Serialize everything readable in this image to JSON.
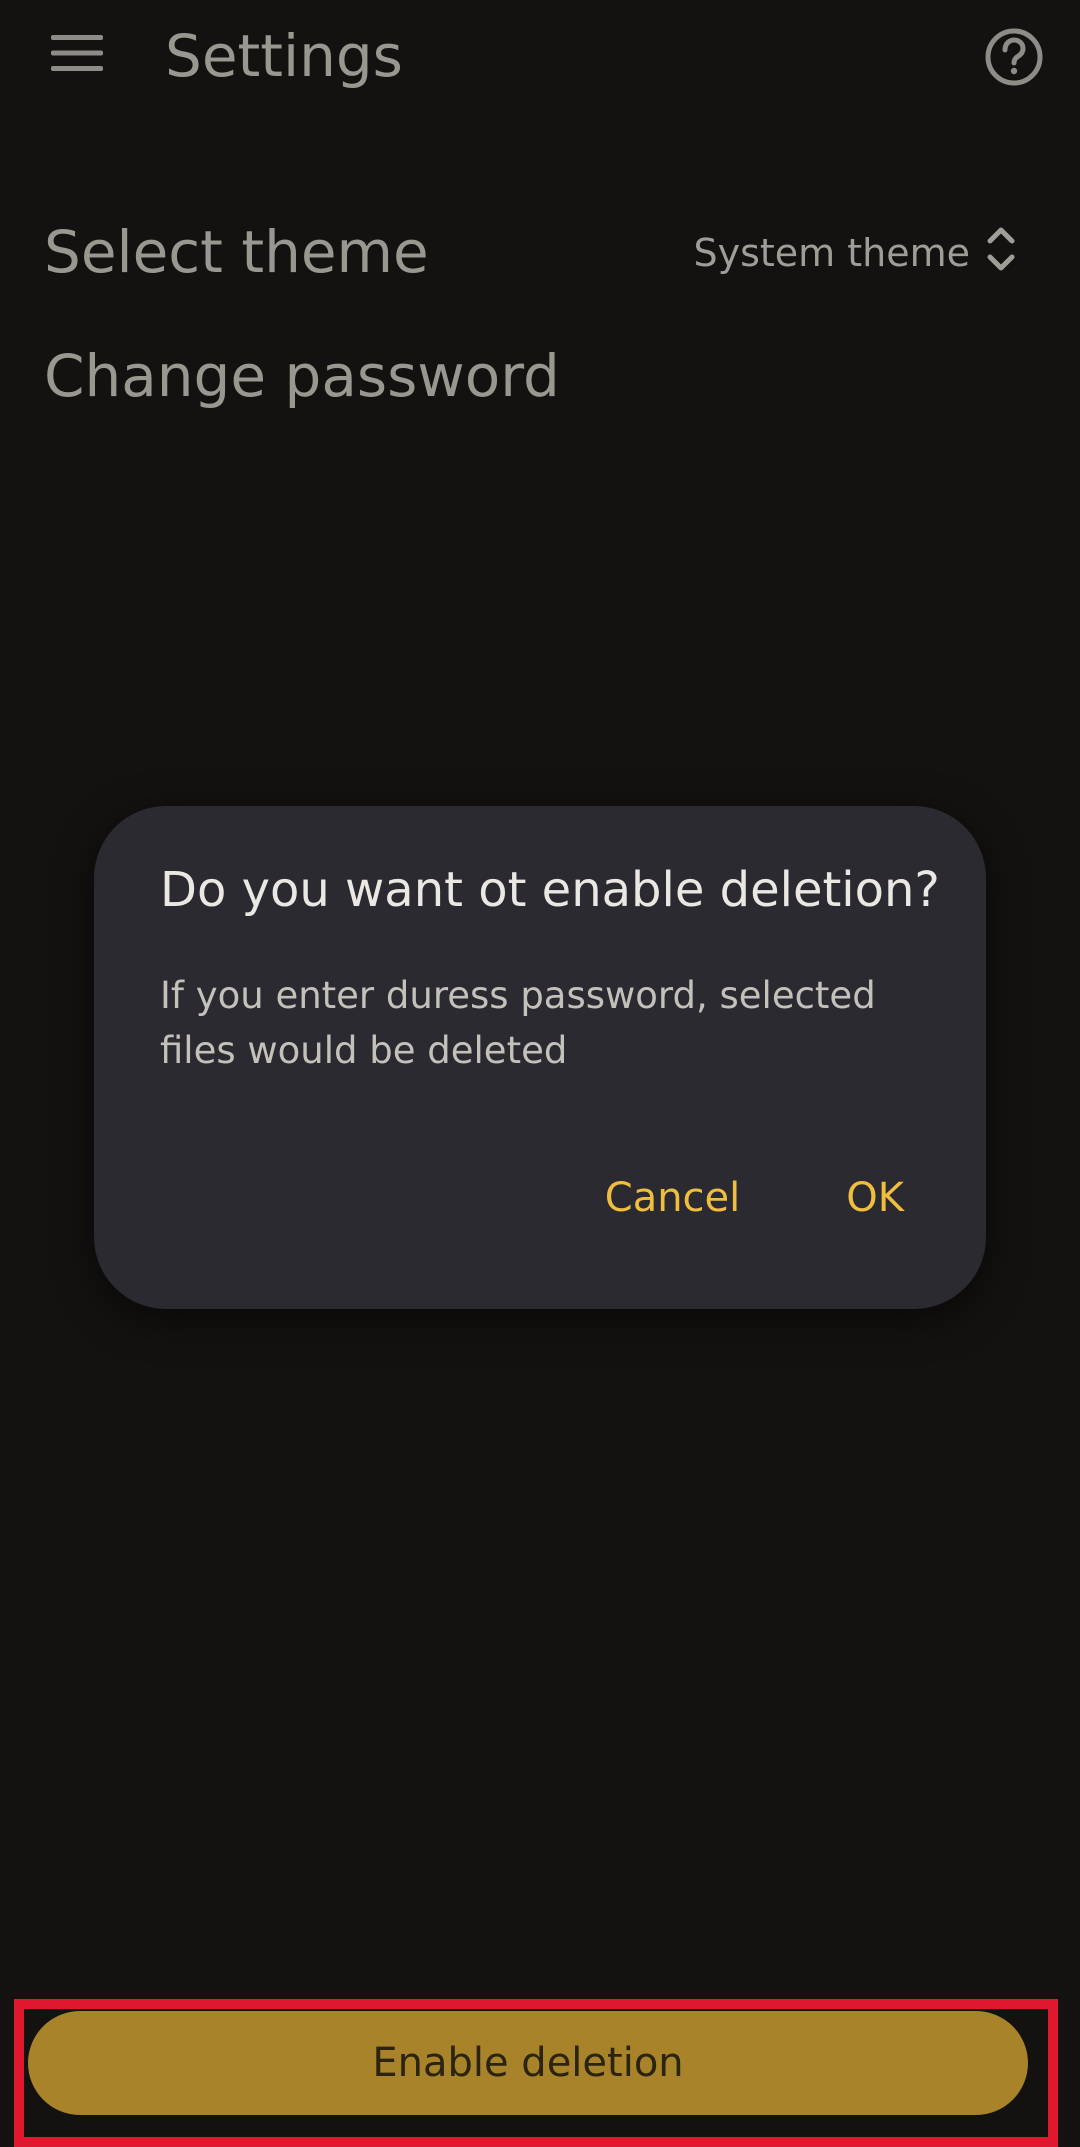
{
  "header": {
    "title": "Settings",
    "menu_icon": "hamburger-menu-icon",
    "help_icon": "help-circle-icon"
  },
  "settings": {
    "theme_label": "Select theme",
    "theme_value": "System theme",
    "theme_value_icon": "unfold-chevrons-icon",
    "password_label": "Change password"
  },
  "dialog": {
    "title": "Do you want ot enable deletion?",
    "message": "If you enter duress password, selected files would be deleted",
    "cancel_label": "Cancel",
    "ok_label": "OK"
  },
  "footer": {
    "enable_button_label": "Enable deletion"
  },
  "colors": {
    "background": "#141210",
    "dialog_surface": "#2b2a31",
    "accent": "#f0be3e",
    "primary_button": "#a8832a",
    "highlight": "#e0182d"
  }
}
